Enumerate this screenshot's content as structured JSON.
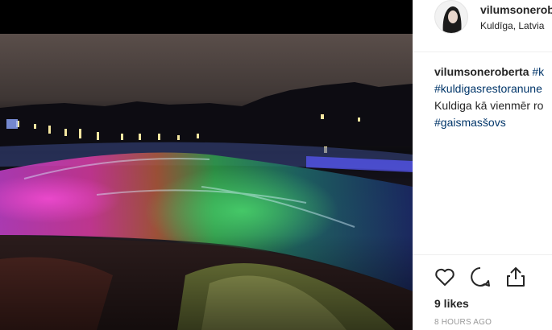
{
  "post": {
    "username": "vilumsoneroberta",
    "username_short": "vilumsonerob",
    "location": "Kuldīga, Latvia",
    "caption_lines": [
      {
        "user": "vilumsoneroberta",
        "tag": "#k"
      },
      {
        "tag": "#kuldigasrestoranune"
      },
      {
        "text": "Kuldiga kā vienmēr ro"
      },
      {
        "tag": "#gaismasšovs"
      }
    ],
    "likes": "9 likes",
    "time": "8 HOURS AGO"
  },
  "icons": {
    "like": "heart-icon",
    "comment": "comment-bubble-icon",
    "share": "share-icon"
  },
  "colors": {
    "link": "#003569",
    "muted": "#999999",
    "text": "#262626"
  }
}
